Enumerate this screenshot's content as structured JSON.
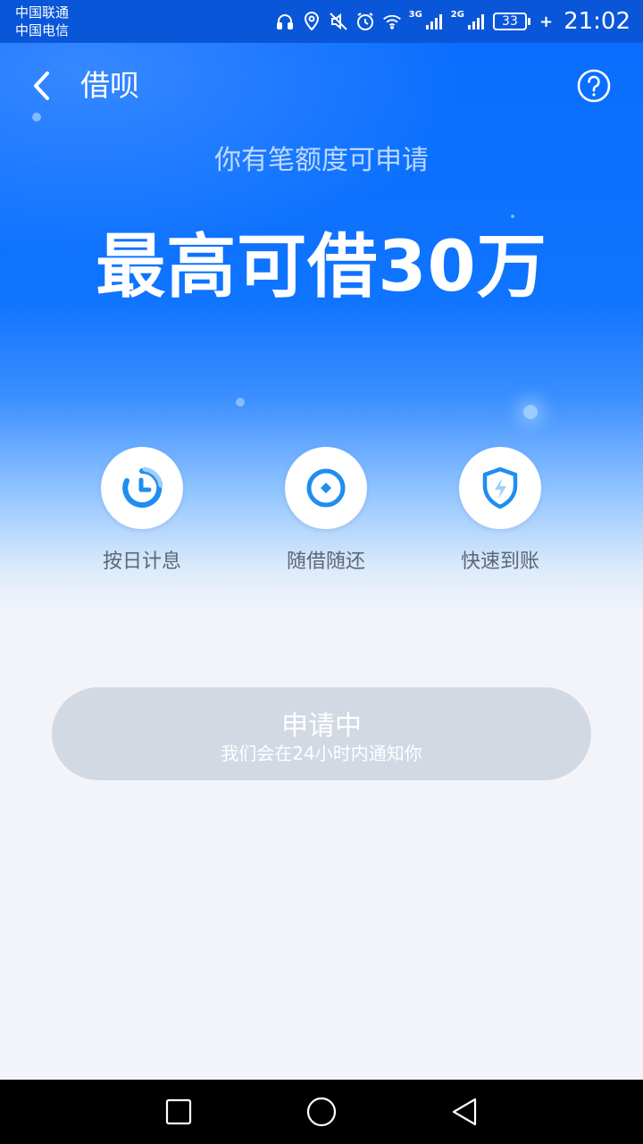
{
  "status_bar": {
    "carrier_1": "中国联通",
    "carrier_2": "中国电信",
    "net_1": "3G",
    "net_2": "2G",
    "battery": "33",
    "time": "21:02",
    "icons": [
      "headset-icon",
      "location-icon",
      "mute-icon",
      "alarm-icon",
      "wifi-icon",
      "signal-icon",
      "signal-icon",
      "battery-icon",
      "charging-icon"
    ]
  },
  "header": {
    "title": "借呗",
    "back_icon": "chevron-left-icon",
    "help_icon": "question-circle-icon"
  },
  "hero": {
    "subtitle": "你有笔额度可申请",
    "headline": "最高可借30万"
  },
  "features": [
    {
      "label": "按日计息",
      "icon": "clock-pie-icon"
    },
    {
      "label": "随借随还",
      "icon": "circle-diamond-icon"
    },
    {
      "label": "快速到账",
      "icon": "shield-bolt-icon"
    }
  ],
  "apply": {
    "title": "申请中",
    "subtitle": "我们会在24小时内通知你"
  },
  "colors": {
    "primary_blue": "#0f74ff",
    "icon_blue": "#1e8ef0",
    "button_disabled": "#d2d9e3",
    "background": "#f3f4f9"
  },
  "nav_bar": {
    "icons": [
      "recent-apps-icon",
      "home-icon",
      "back-icon"
    ]
  }
}
